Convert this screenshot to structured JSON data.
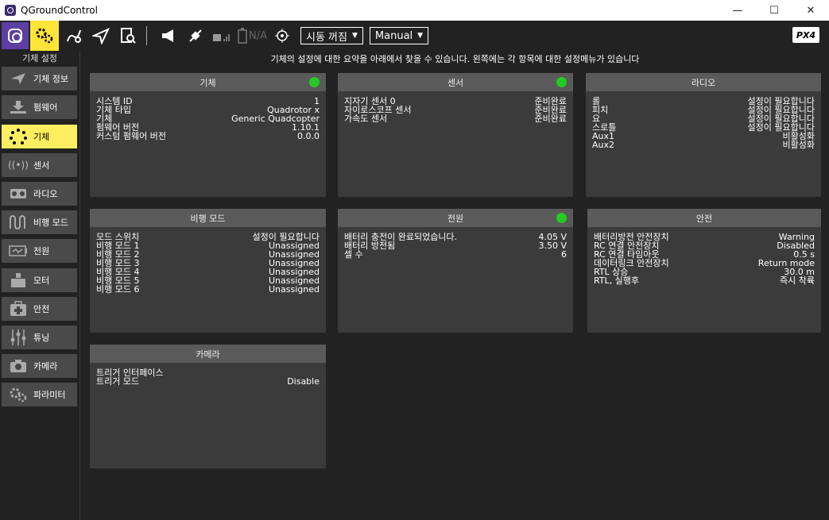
{
  "window": {
    "title": "QGroundControl",
    "min": "—",
    "max": "☐",
    "close": "✕"
  },
  "toolbar": {
    "battery_text": "N/A",
    "mode_combo": "시동 꺼짐",
    "flight_combo": "Manual",
    "brand": "PX4"
  },
  "sidebar": {
    "title": "기체 설정",
    "items": [
      {
        "label": "기체 정보",
        "icon": "plane-icon"
      },
      {
        "label": "펌웨어",
        "icon": "download-icon"
      },
      {
        "label": "기체",
        "icon": "airframe-icon"
      },
      {
        "label": "센서",
        "icon": "sensor-icon"
      },
      {
        "label": "라디오",
        "icon": "radio-icon"
      },
      {
        "label": "비행 모드",
        "icon": "flight-mode-icon"
      },
      {
        "label": "전원",
        "icon": "power-icon"
      },
      {
        "label": "모터",
        "icon": "motor-icon"
      },
      {
        "label": "안전",
        "icon": "safety-icon"
      },
      {
        "label": "튜닝",
        "icon": "tuning-icon"
      },
      {
        "label": "카메라",
        "icon": "camera-icon"
      },
      {
        "label": "파라미터",
        "icon": "parameters-icon"
      }
    ]
  },
  "header_msg": "기체의 설정에 대한 요약을 아래에서 찾을 수 있습니다. 왼쪽에는 각 항목에 대한 설정메뉴가 있습니다",
  "panels": {
    "vehicle": {
      "title": "기체",
      "rows": [
        {
          "k": "시스템 ID",
          "v": "1"
        },
        {
          "k": "기체 타입",
          "v": "Quadrotor x"
        },
        {
          "k": "기체",
          "v": "Generic Quadcopter"
        },
        {
          "k": "펌웨어 버전",
          "v": "1.10.1"
        },
        {
          "k": "커스텀 펌웨어 버전",
          "v": "0.0.0"
        }
      ]
    },
    "sensors": {
      "title": "센서",
      "rows": [
        {
          "k": "지자기 센서 0",
          "v": "준비완료"
        },
        {
          "k": "자이로스코프 센서",
          "v": "준비완료"
        },
        {
          "k": "가속도 센서",
          "v": "준비완료"
        }
      ]
    },
    "radio": {
      "title": "라디오",
      "rows": [
        {
          "k": "롤",
          "v": "설정이 필요합니다"
        },
        {
          "k": "피치",
          "v": "설정이 필요합니다"
        },
        {
          "k": "요",
          "v": "설정이 필요합니다"
        },
        {
          "k": "스로틀",
          "v": "설정이 필요합니다"
        },
        {
          "k": "Aux1",
          "v": "비활성화"
        },
        {
          "k": "Aux2",
          "v": "비활성화"
        }
      ]
    },
    "flightmodes": {
      "title": "비행 모드",
      "rows": [
        {
          "k": "모드 스위치",
          "v": "설정이 필요합니다"
        },
        {
          "k": "비행 모드 1",
          "v": "Unassigned"
        },
        {
          "k": "비행 모드 2",
          "v": "Unassigned"
        },
        {
          "k": "비행 모드 3",
          "v": "Unassigned"
        },
        {
          "k": "비행 모드 4",
          "v": "Unassigned"
        },
        {
          "k": "비행 모드 5",
          "v": "Unassigned"
        },
        {
          "k": "비행 모드 6",
          "v": "Unassigned"
        }
      ]
    },
    "power": {
      "title": "전원",
      "rows": [
        {
          "k": "배터리 충전이 완료되었습니다.",
          "v": "4.05 V"
        },
        {
          "k": "배터리 방전됨",
          "v": "3.50 V"
        },
        {
          "k": "셀 수",
          "v": "6"
        }
      ]
    },
    "safety": {
      "title": "안전",
      "rows": [
        {
          "k": "배터리방전 안전장치",
          "v": "Warning"
        },
        {
          "k": "RC 연결 안전장치",
          "v": "Disabled"
        },
        {
          "k": "RC 연결 타임아웃",
          "v": "0.5 s"
        },
        {
          "k": "데이터링크 안전장치",
          "v": "Return mode"
        },
        {
          "k": "RTL 상승",
          "v": "30.0 m"
        },
        {
          "k": "RTL, 실행후",
          "v": "즉시 착륙"
        }
      ]
    },
    "camera": {
      "title": "카메라",
      "rows": [
        {
          "k": "트리거 인터페이스",
          "v": ""
        },
        {
          "k": "트리거 모드",
          "v": "Disable"
        }
      ]
    }
  },
  "colors": {
    "accent": "#ffee60",
    "status_ok": "#22cc22",
    "panel": "#3b3b3b",
    "panel_header": "#5a5a5a"
  }
}
